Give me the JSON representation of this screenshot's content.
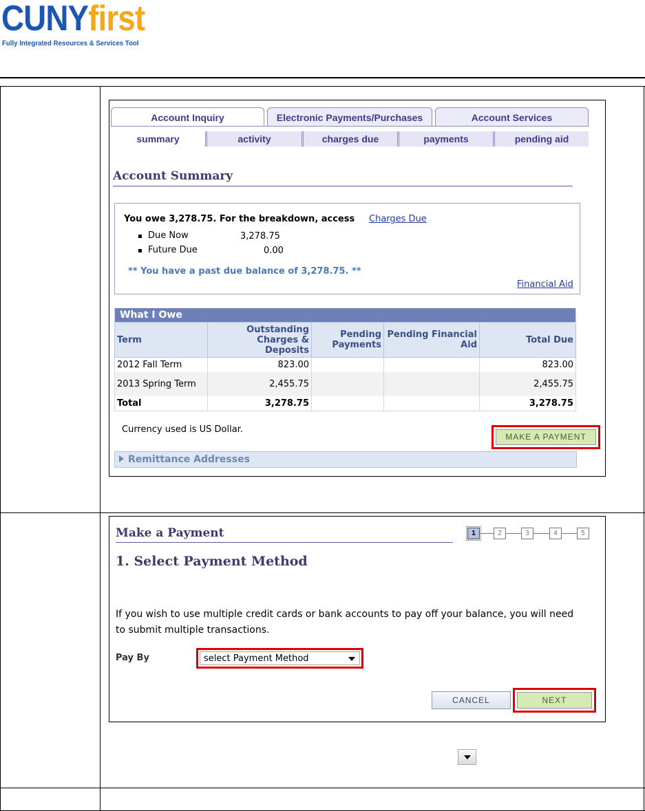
{
  "logo": {
    "brand_primary": "CUNY",
    "brand_secondary": "first",
    "tagline": "Fully Integrated Resources & Services Tool"
  },
  "tabs": [
    "Account Inquiry",
    "Electronic Payments/Purchases",
    "Account Services"
  ],
  "subtabs": [
    "summary",
    "activity",
    "charges due",
    "payments",
    "pending aid"
  ],
  "account_summary": {
    "title": "Account Summary",
    "owe_text": "You owe 3,278.75.  For the breakdown, access",
    "charges_due_link": "Charges Due",
    "due_now_label": "Due Now",
    "due_now_value": "3,278.75",
    "future_due_label": "Future Due",
    "future_due_value": "0.00",
    "past_due_note": "** You have a past due balance of 3,278.75. **",
    "financial_aid_link": "Financial Aid"
  },
  "what_i_owe": {
    "caption": "What I Owe",
    "headers": [
      "Term",
      "Outstanding Charges & Deposits",
      "Pending Payments",
      "Pending Financial Aid",
      "Total Due"
    ],
    "rows": [
      [
        "2012 Fall Term",
        "823.00",
        "",
        "",
        "823.00"
      ],
      [
        "2013 Spring Term",
        "2,455.75",
        "",
        "",
        "2,455.75"
      ]
    ],
    "total": [
      "Total",
      "3,278.75",
      "",
      "",
      "3,278.75"
    ]
  },
  "currency_note": "Currency used is US Dollar.",
  "make_payment_button": "Make a Payment",
  "remittance_label": "Remittance Addresses",
  "make_payment": {
    "title": "Make a Payment",
    "steps": [
      "1",
      "2",
      "3",
      "4",
      "5"
    ],
    "subtitle": "1. Select Payment Method",
    "instructions": "If you wish to use multiple credit cards or bank accounts to pay off your balance, you will need to submit multiple transactions.",
    "pay_by_label": "Pay By",
    "pay_by_value": "select Payment Method",
    "cancel_button": "Cancel",
    "next_button": "Next"
  },
  "colors": {
    "highlight": "#e00000",
    "tab_text": "#3d3a8a",
    "grid_header": "#6d80b7",
    "button_green": "#d7eab3"
  }
}
